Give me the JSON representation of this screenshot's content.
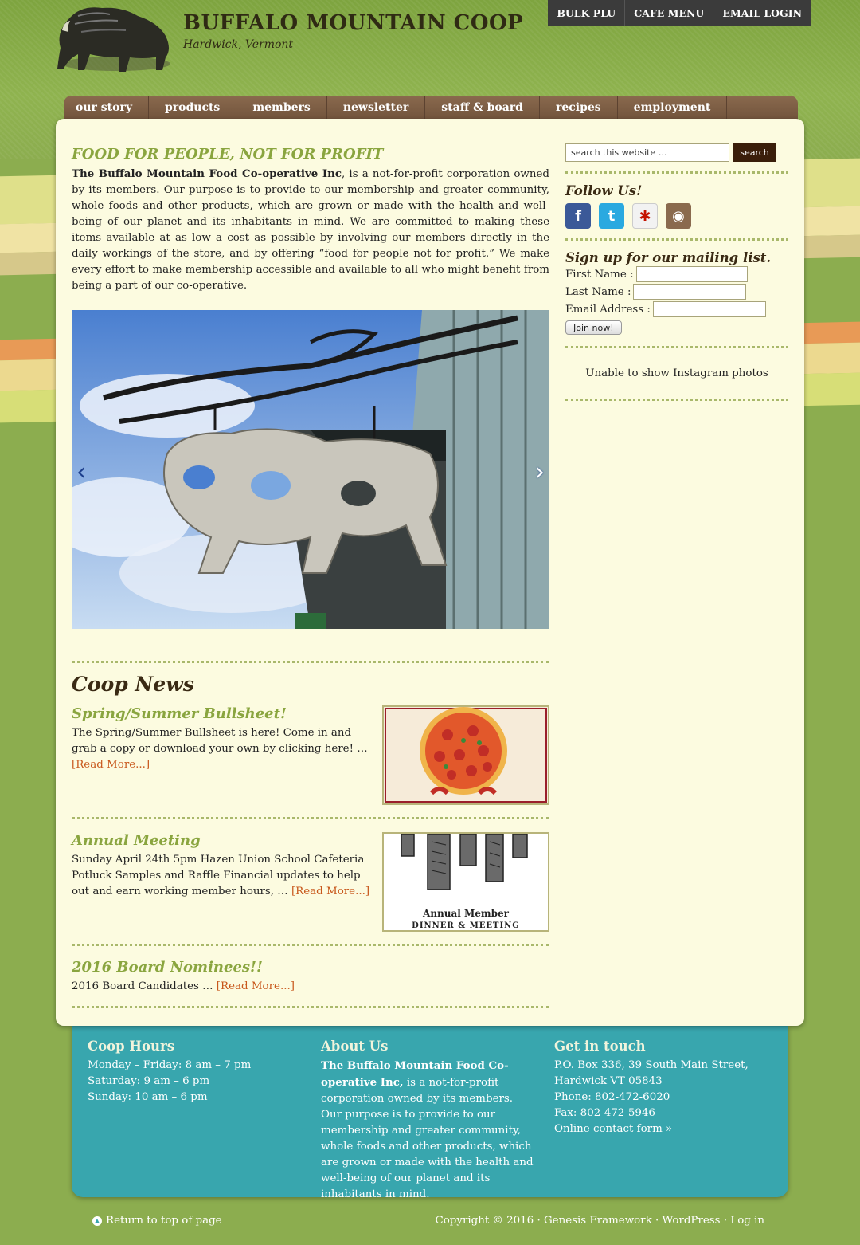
{
  "header": {
    "title": "BUFFALO MOUNTAIN COOP",
    "description": "Hardwick, Vermont",
    "top_menu": [
      "BULK PLU",
      "CAFE MENU",
      "EMAIL LOGIN"
    ]
  },
  "nav": [
    "our story",
    "products",
    "members",
    "newsletter",
    "staff & board",
    "recipes",
    "employment"
  ],
  "main": {
    "entry_title": "FOOD FOR PEOPLE, NOT FOR PROFIT",
    "intro_bold": "The Buffalo Mountain Food Co-operative Inc",
    "intro_rest": ", is a not-for-profit corporation owned by its members. Our purpose is to provide to our membership and greater community, whole foods and other products, which are grown or made with the health and well-being of our planet and its inhabitants in mind. We are committed to making these items available at as low a cost as possible by involving our members directly in the daily workings of the store, and by offering “food for people not for profit.” We make every effort to make membership accessible and available to all who might benefit from being a part of our co-operative.",
    "slider": {
      "prev": "‹",
      "next": "›"
    },
    "news_title": "Coop News",
    "posts": [
      {
        "title": "Spring/Summer Bullsheet!",
        "excerpt": "The Spring/Summer Bullsheet is here! Come in and grab a copy or download your own by clicking here! … ",
        "more": "[Read More...]"
      },
      {
        "title": "Annual Meeting",
        "excerpt": " Sunday April 24th 5pm Hazen Union School Cafeteria Potluck Samples and Raffle Financial updates to help out and earn working member hours, … ",
        "more": "[Read More...]",
        "thumb_text_1": "Annual Member",
        "thumb_text_2": "DINNER & MEETING"
      },
      {
        "title": "2016 Board Nominees!!",
        "excerpt": "2016 Board Candidates … ",
        "more": "[Read More...]"
      }
    ]
  },
  "sidebar": {
    "search_placeholder": "search this website …",
    "search_button": "search",
    "follow_title": "Follow Us!",
    "social": [
      {
        "name": "facebook-icon",
        "glyph": "f",
        "color": "#3b5998"
      },
      {
        "name": "twitter-icon",
        "glyph": "t",
        "color": "#2aa9e0"
      },
      {
        "name": "yelp-icon",
        "glyph": "✱",
        "color": "#ffffff"
      },
      {
        "name": "instagram-icon",
        "glyph": "◉",
        "color": "#8a6a4e"
      }
    ],
    "mailing_title": "Sign up for our mailing list.",
    "first_name_label": "First Name :",
    "last_name_label": "Last Name :",
    "email_label": "Email Address :",
    "join_button": "Join now!",
    "instagram_text": "Unable to show Instagram photos"
  },
  "footer_widgets": {
    "hours_title": "Coop Hours",
    "hours": [
      "Monday – Friday: 8 am – 7 pm",
      "Saturday: 9 am – 6 pm",
      "Sunday: 10 am – 6 pm"
    ],
    "about_title": "About Us",
    "about_bold": "The Buffalo Mountain Food Co-operative Inc,",
    "about_rest": " is a not-for-profit corporation owned by its members. Our purpose is to provide to our membership and greater community, whole foods and other products, which are grown or made with the health and well-being of our planet and its inhabitants in mind.",
    "contact_title": "Get in touch",
    "contact": [
      "P.O. Box 336, 39 South Main Street,",
      "Hardwick VT 05843",
      "Phone: 802-472-6020",
      "Fax: 802-472-5946"
    ],
    "contact_link": "Online contact form »"
  },
  "footer": {
    "back_to_top": "Return to top of page",
    "copyright": "Copyright © 2016 · ",
    "genesis": "Genesis Framework",
    "sep": " · ",
    "wordpress": "WordPress",
    "login": "Log in"
  },
  "colors": {
    "accent_green": "#8aa53f",
    "footer_teal": "#38a6ae",
    "nav_brown": "#6e5039",
    "link_orange": "#c8581c"
  }
}
